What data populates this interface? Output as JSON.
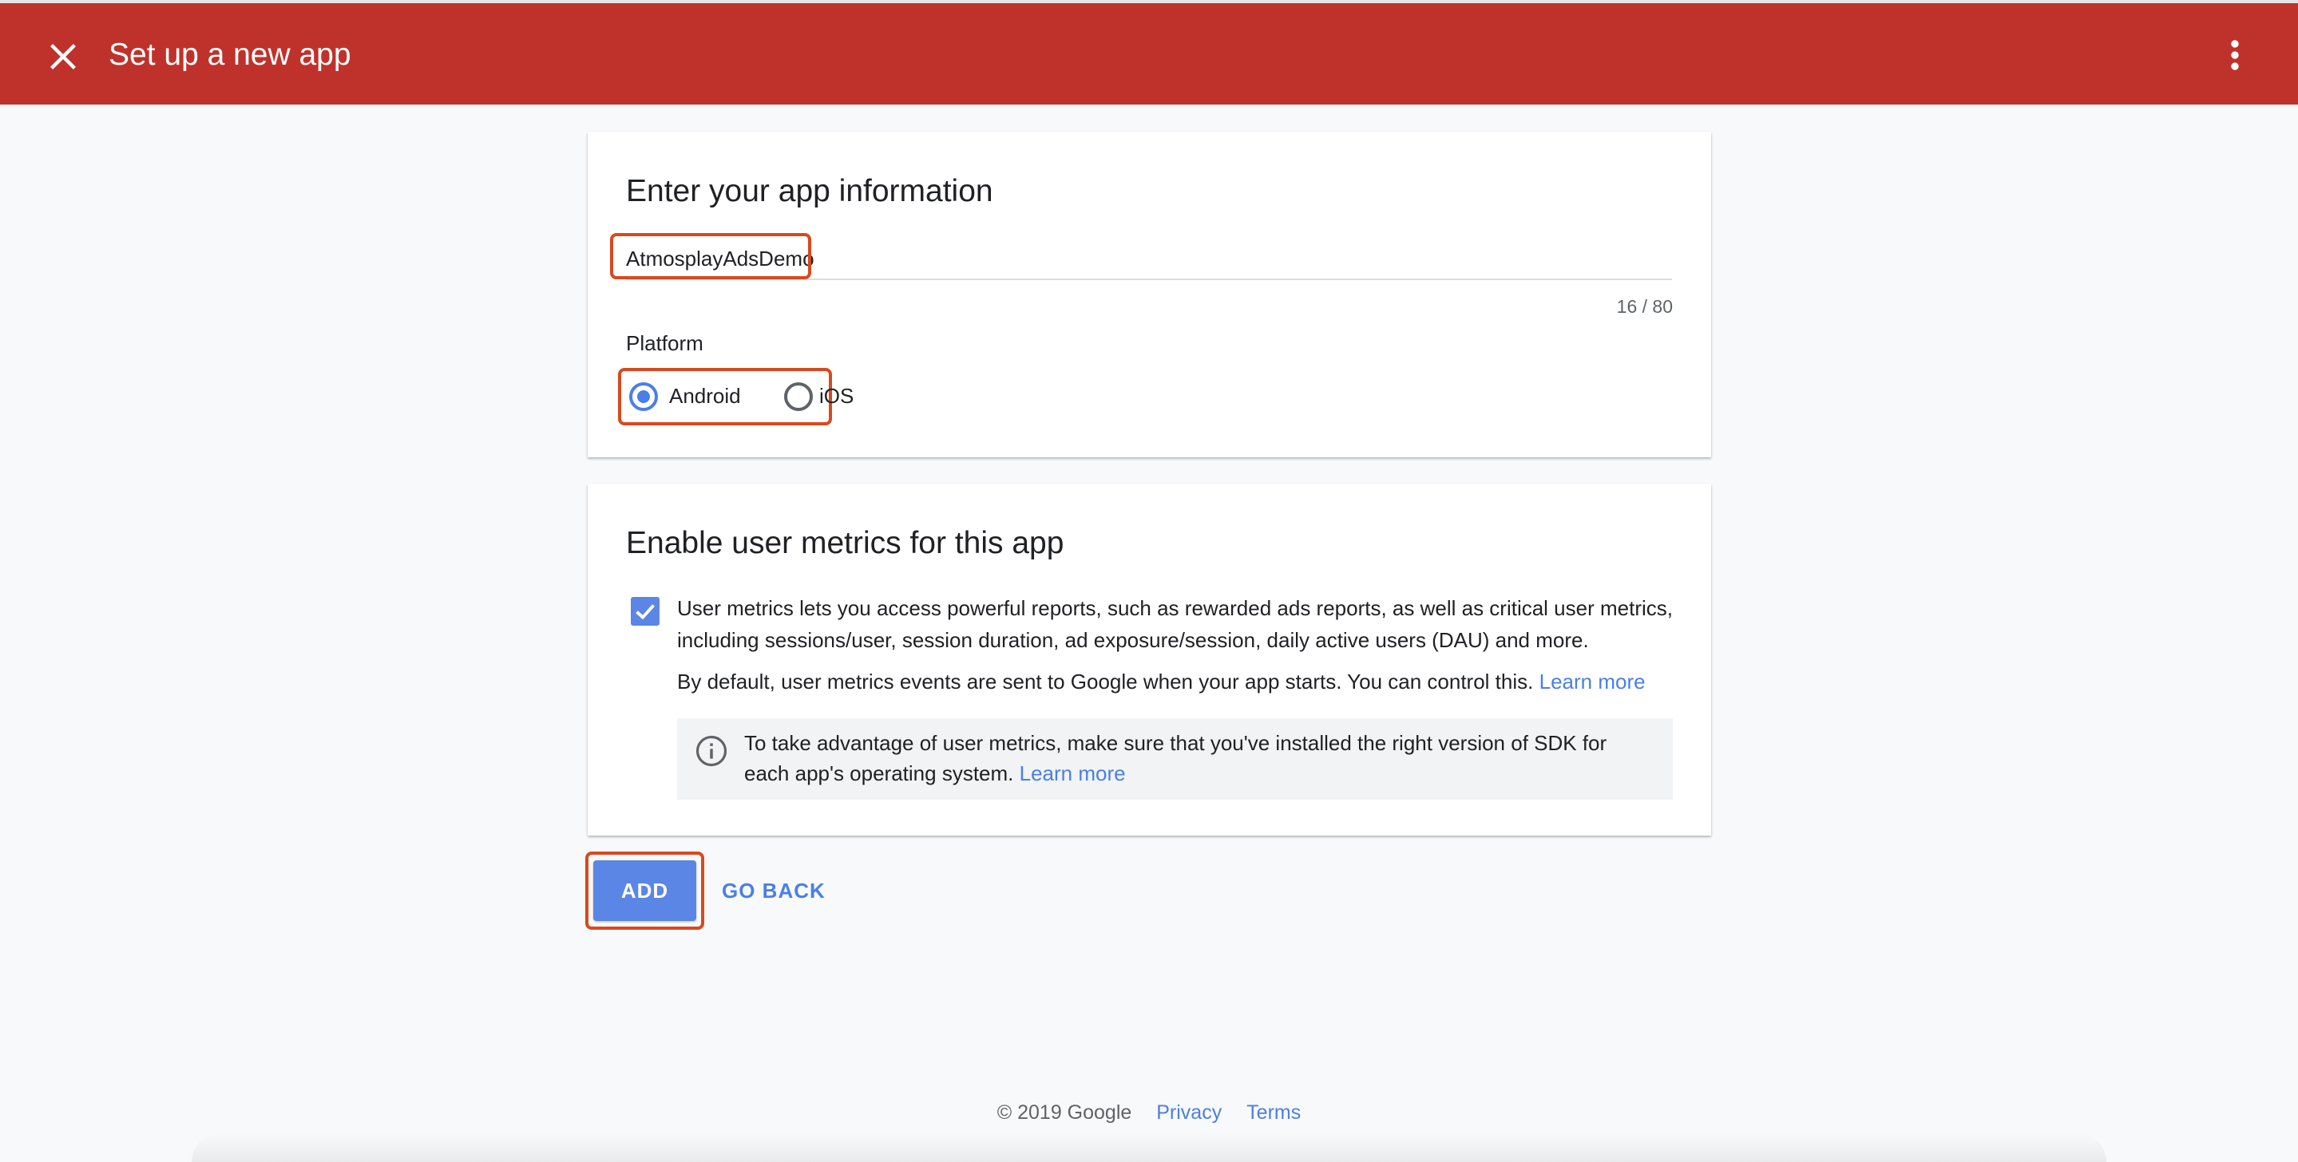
{
  "header": {
    "title": "Set up a new app",
    "background": "#bf322c"
  },
  "app_info": {
    "title": "Enter your app information",
    "name_value": "AtmosplayAdsDemo",
    "char_count": "16 / 80",
    "platform_label": "Platform",
    "platforms": [
      {
        "label": "Android",
        "selected": true
      },
      {
        "label": "iOS",
        "selected": false
      }
    ]
  },
  "metrics": {
    "title": "Enable user metrics for this app",
    "checked": true,
    "description": "User metrics lets you access powerful reports, such as rewarded ads reports, as well as critical user metrics, including sessions/user, session duration, ad exposure/session, daily active users (DAU) and more.",
    "default_text": "By default, user metrics events are sent to Google when your app starts. You can control this.",
    "default_link": "Learn more",
    "info_text": "To take advantage of user metrics, make sure that you've installed the right version of SDK for each app's operating system.",
    "info_link": "Learn more"
  },
  "actions": {
    "add_label": "ADD",
    "goback_label": "GO BACK"
  },
  "footer": {
    "copyright": "© 2019 Google",
    "privacy": "Privacy",
    "terms": "Terms"
  },
  "colors": {
    "accent": "#4a7fe8",
    "highlight": "#d9491e"
  }
}
